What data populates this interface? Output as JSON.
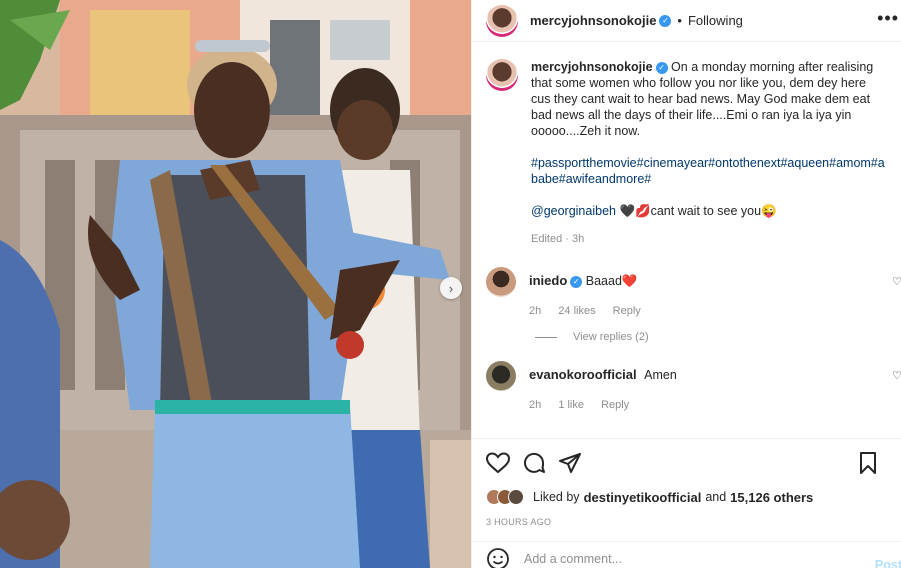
{
  "post": {
    "username": "mercyjohnsonokojie",
    "following_label": "Following",
    "more_label": "•••",
    "caption_text": "On a monday morning after realising that some women who follow you nor like you, dem dey here cus they cant wait to hear bad news. May God make dem eat bad news all the days of their life....Emi o ran iya la iya yin ooooo....Zeh it now.",
    "hashtags": "#passportthemovie#cinemayear#ontothenext#aqueen#amom#ababe#awifeandmore#",
    "mention": "@georginaibeh",
    "mention_suffix": "🖤💋cant wait to see you😜",
    "edited": "Edited · 3h"
  },
  "comments": [
    {
      "username": "iniedo",
      "verified": true,
      "text": "Baaad❤️",
      "time": "2h",
      "likes": "24 likes",
      "reply_label": "Reply",
      "view_replies": "View replies (2)"
    },
    {
      "username": "evanokoroofficial",
      "verified": false,
      "text": "Amen",
      "time": "2h",
      "likes": "1 like",
      "reply_label": "Reply"
    }
  ],
  "likes": {
    "prefix": "Liked by",
    "user": "destinyetikoofficial",
    "middle": "and",
    "count": "15,126 others"
  },
  "timestamp": "3 HOURS AGO",
  "add_comment": {
    "placeholder": "Add a comment...",
    "post_label": "Post"
  },
  "colors": {
    "link": "#00376b",
    "verified": "#3897f0",
    "secondary_text": "#8e8e8e",
    "post_button": "#b2dffc"
  },
  "icons": [
    "heart-icon",
    "comment-icon",
    "share-icon",
    "bookmark-icon",
    "emoji-icon",
    "next-arrow-icon",
    "more-options-icon",
    "verified-icon"
  ]
}
